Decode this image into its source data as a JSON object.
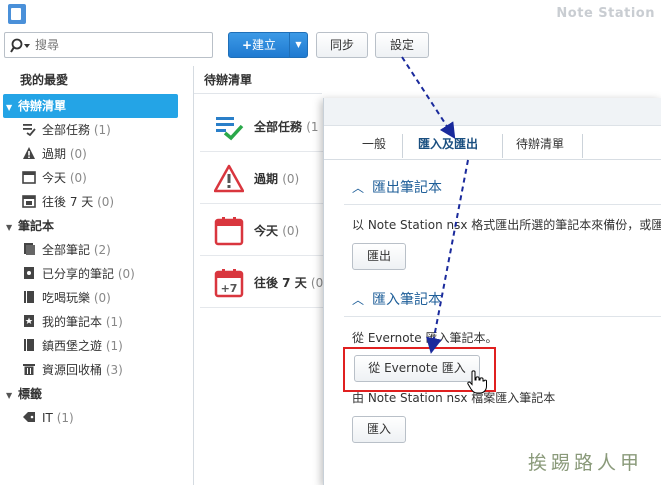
{
  "app": {
    "title": "Note Station"
  },
  "toolbar": {
    "search_placeholder": "搜尋",
    "create_label": "建立",
    "sync_label": "同步",
    "settings_label": "設定"
  },
  "sidebar": {
    "favorites": "我的最愛",
    "todo_group": "待辦清單",
    "todo_items": [
      {
        "label": "全部任務",
        "count": "(1)",
        "icon": "checklist-icon"
      },
      {
        "label": "過期",
        "count": "(0)",
        "icon": "warning-icon"
      },
      {
        "label": "今天",
        "count": "(0)",
        "icon": "calendar-icon"
      },
      {
        "label": "往後 7 天",
        "count": "(0)",
        "icon": "calendar-plus7-icon"
      }
    ],
    "notebooks_group": "筆記本",
    "notebook_items": [
      {
        "label": "全部筆記",
        "count": "(2)",
        "icon": "notes-icon"
      },
      {
        "label": "已分享的筆記",
        "count": "(0)",
        "icon": "shared-notes-icon"
      },
      {
        "label": "吃喝玩樂",
        "count": "(0)",
        "icon": "notebook-icon"
      },
      {
        "label": "我的筆記本",
        "count": "(1)",
        "icon": "star-notebook-icon"
      },
      {
        "label": "鎮西堡之遊",
        "count": "(1)",
        "icon": "notebook-icon"
      },
      {
        "label": "資源回收桶",
        "count": "(3)",
        "icon": "trash-icon"
      }
    ],
    "tags_group": "標籤",
    "tag_items": [
      {
        "label": "IT",
        "count": "(1)",
        "icon": "tag-icon"
      }
    ]
  },
  "middle": {
    "header": "待辦清單",
    "rows": [
      {
        "label": "全部任務",
        "count": "(1"
      },
      {
        "label": "過期",
        "count": "(0)"
      },
      {
        "label": "今天",
        "count": "(0)"
      },
      {
        "label": "往後 7 天",
        "count": "(0)"
      }
    ]
  },
  "panel": {
    "tabs": [
      "一般",
      "匯入及匯出",
      "待辦清單"
    ],
    "active_tab": "匯入及匯出",
    "export_title": "匯出筆記本",
    "export_desc": "以 Note Station nsx 格式匯出所選的筆記本來備份，或匯",
    "export_button": "匯出",
    "import_title": "匯入筆記本",
    "import_evernote_desc": "從 Evernote 匯入筆記本。",
    "import_evernote_button": "從 Evernote 匯入",
    "import_nsx_desc": "由 Note Station nsx 檔案匯入筆記本",
    "import_button": "匯入"
  },
  "watermark": "挨踢路人甲",
  "colors": {
    "accent": "#24a4e6",
    "section_title": "#1f5f99",
    "highlight": "#e02020",
    "annotation_arrow": "#1a2a9c"
  }
}
